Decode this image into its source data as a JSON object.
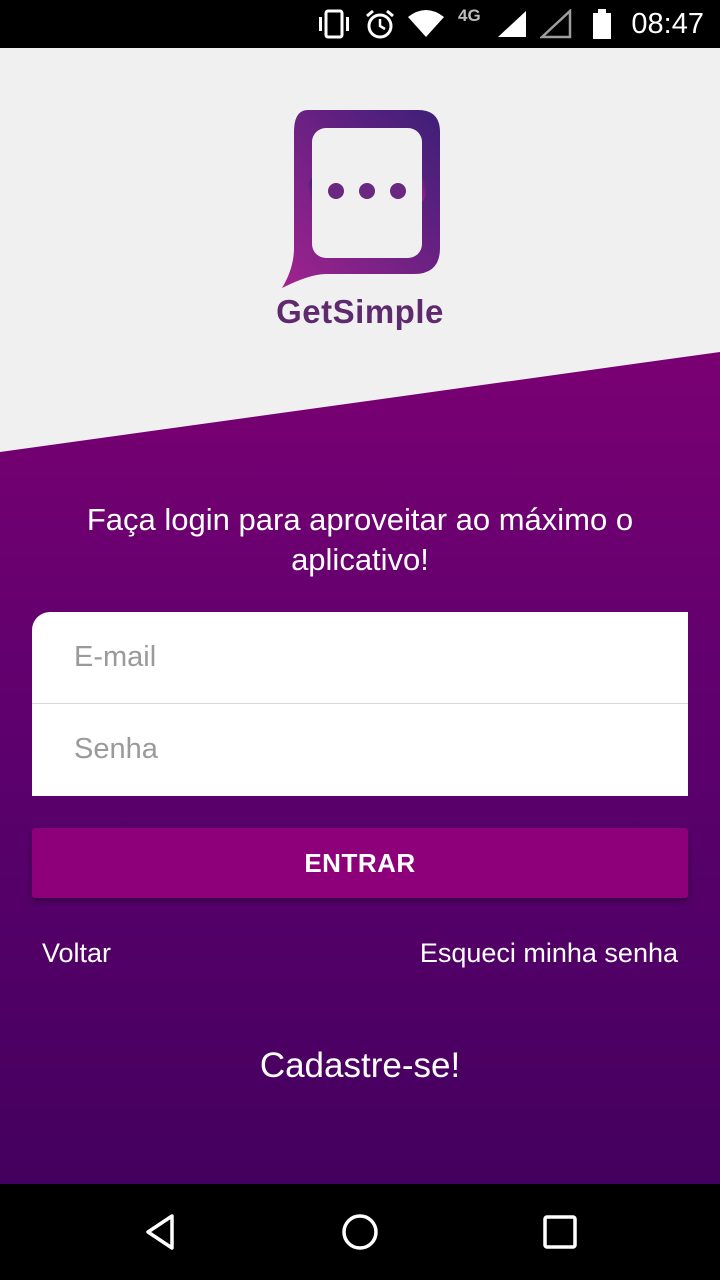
{
  "status_bar": {
    "time": "08:47",
    "network": "4G",
    "icons": [
      "vibrate-icon",
      "alarm-icon",
      "wifi-icon",
      "signal-icon",
      "signal-empty-icon",
      "battery-icon"
    ]
  },
  "brand": {
    "name": "GetSimple",
    "logo_icon": "chat-bubble-logo-icon",
    "colors": {
      "primary": "#8e0079",
      "logo_dark": "#4a1f7a",
      "logo_light": "#9b2a8f",
      "text": "#5e2a6e"
    }
  },
  "login": {
    "headline": "Faça login para aproveitar ao máximo o aplicativo!",
    "email_placeholder": "E-mail",
    "email_value": "",
    "password_placeholder": "Senha",
    "password_value": "",
    "submit_label": "ENTRAR",
    "back_label": "Voltar",
    "forgot_label": "Esqueci minha senha",
    "signup_label": "Cadastre-se!"
  },
  "nav_bar": {
    "icons": [
      "back-triangle-icon",
      "home-circle-icon",
      "recents-square-icon"
    ]
  }
}
